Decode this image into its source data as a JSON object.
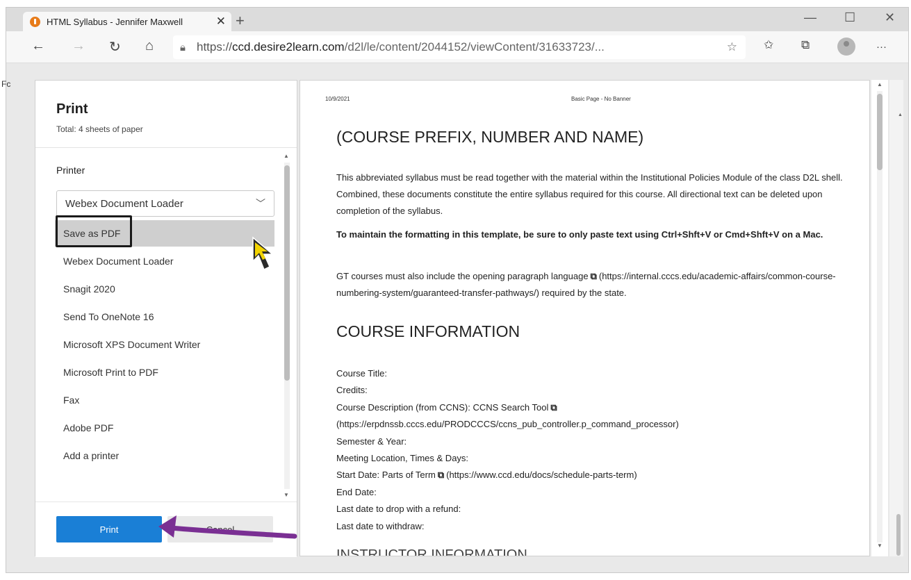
{
  "browser": {
    "tab_title": "HTML Syllabus - Jennifer Maxwell",
    "tab_close": "✕",
    "new_tab": "+",
    "minimize": "—",
    "maximize": "☐",
    "close": "✕",
    "back": "←",
    "forward": "→",
    "refresh": "↻",
    "home": "⌂",
    "url_prefix": "https://",
    "url_host": "ccd.desire2learn.com",
    "url_path": "/d2l/le/content/2044152/viewContent/31633723/...",
    "favorites_star": "☆",
    "favorites": "✩",
    "collections": "⧉",
    "more": "···",
    "favbar_fragment": "Fc"
  },
  "print_dialog": {
    "title": "Print",
    "total": "Total: 4 sheets of paper",
    "printer_label": "Printer",
    "selected_printer": "Webex Document Loader",
    "printer_options": [
      "Save as PDF",
      "Webex Document Loader",
      "Snagit 2020",
      "Send To OneNote 16",
      "Microsoft XPS Document Writer",
      "Microsoft Print to PDF",
      "Fax",
      "Adobe PDF",
      "Add a printer"
    ],
    "print_button": "Print",
    "cancel_button": "Cancel"
  },
  "preview": {
    "date": "10/9/2021",
    "page_header": "Basic Page - No Banner",
    "heading1": "(COURSE PREFIX, NUMBER AND NAME)",
    "para1": "This abbreviated syllabus must be read together with the material within the Institutional Policies Module of the class D2L shell. Combined, these documents constitute the entire syllabus required for this course. All directional text can be deleted upon completion of the syllabus.",
    "para2": "To maintain the formatting in this template, be sure to only paste text using Ctrl+Shft+V or Cmd+Shft+V on a Mac.",
    "para3_a": "GT courses must also include the opening paragraph language",
    "para3_b": "(https://internal.cccs.edu/academic-affairs/common-course-numbering-system/guaranteed-transfer-pathways/) required by the state.",
    "heading2": "COURSE INFORMATION",
    "info": {
      "course_title": "Course Title:",
      "credits": "Credits:",
      "desc_a": "Course Description (from CCNS): CCNS Search Tool",
      "desc_b": "(https://erpdnssb.cccs.edu/PRODCCCS/ccns_pub_controller.p_command_processor)",
      "semester": "Semester & Year:",
      "meeting": "Meeting Location, Times & Days:",
      "start_a": "Start Date: Parts of Term",
      "start_b": "(https://www.ccd.edu/docs/schedule-parts-term)",
      "end": "End Date:",
      "refund": "Last date to drop with a refund:",
      "withdraw": "Last date to withdraw:"
    },
    "cut_heading": "INSTRUCTOR INFORMATION"
  },
  "annotation": {
    "arrow_color": "#7a2f93",
    "highlight_color": "#1a1a1a"
  }
}
